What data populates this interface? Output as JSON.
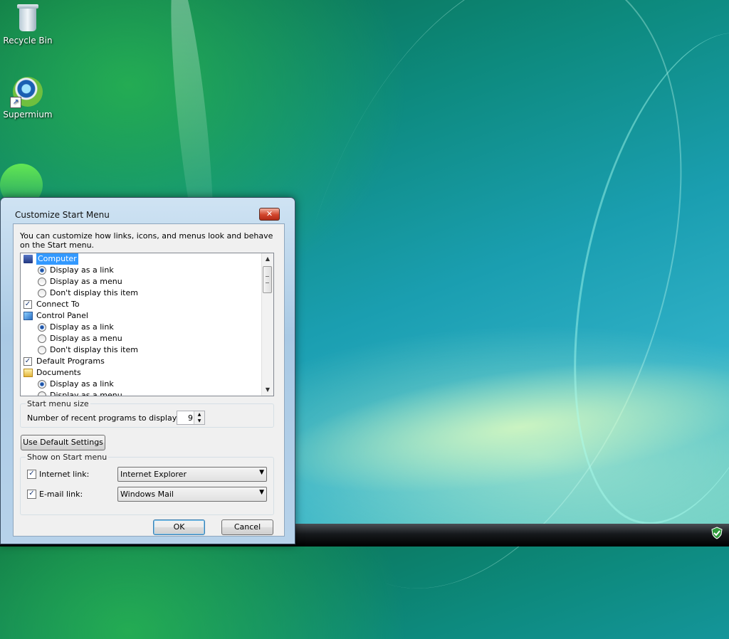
{
  "desktop": {
    "icons": [
      {
        "label": "Recycle Bin"
      },
      {
        "label": "Supermium"
      }
    ]
  },
  "dialog": {
    "title": "Customize Start Menu",
    "close_glyph": "✕",
    "intro": "You can customize how links, icons, and menus look and behave on the Start menu.",
    "tree": [
      {
        "label": "Computer",
        "level": 0,
        "kind": "folder",
        "icon": "computer-icon",
        "selected": true
      },
      {
        "label": "Display as a link",
        "level": 1,
        "kind": "radio",
        "checked": true
      },
      {
        "label": "Display as a menu",
        "level": 1,
        "kind": "radio",
        "checked": false
      },
      {
        "label": "Don't display this item",
        "level": 1,
        "kind": "radio",
        "checked": false
      },
      {
        "label": "Connect To",
        "level": 0,
        "kind": "checkbox",
        "checked": true
      },
      {
        "label": "Control Panel",
        "level": 0,
        "kind": "folder",
        "icon": "control-panel-icon"
      },
      {
        "label": "Display as a link",
        "level": 1,
        "kind": "radio",
        "checked": true
      },
      {
        "label": "Display as a menu",
        "level": 1,
        "kind": "radio",
        "checked": false
      },
      {
        "label": "Don't display this item",
        "level": 1,
        "kind": "radio",
        "checked": false
      },
      {
        "label": "Default Programs",
        "level": 0,
        "kind": "checkbox",
        "checked": true
      },
      {
        "label": "Documents",
        "level": 0,
        "kind": "folder",
        "icon": "documents-icon"
      },
      {
        "label": "Display as a link",
        "level": 1,
        "kind": "radio",
        "checked": true
      },
      {
        "label": "Display as a menu",
        "level": 1,
        "kind": "radio",
        "checked": false
      }
    ],
    "start_menu_size": {
      "group_label": "Start menu size",
      "recent_label": "Number of recent programs to display:",
      "recent_value": "9"
    },
    "default_settings_label": "Use Default Settings",
    "show_on_start": {
      "group_label": "Show on Start menu",
      "internet_label": "Internet link:",
      "internet_checked": true,
      "internet_value": "Internet Explorer",
      "email_label": "E-mail link:",
      "email_checked": true,
      "email_value": "Windows Mail"
    },
    "ok_label": "OK",
    "cancel_label": "Cancel"
  },
  "colors": {
    "selection": "#3399ff",
    "close_button": "#d2452b"
  }
}
